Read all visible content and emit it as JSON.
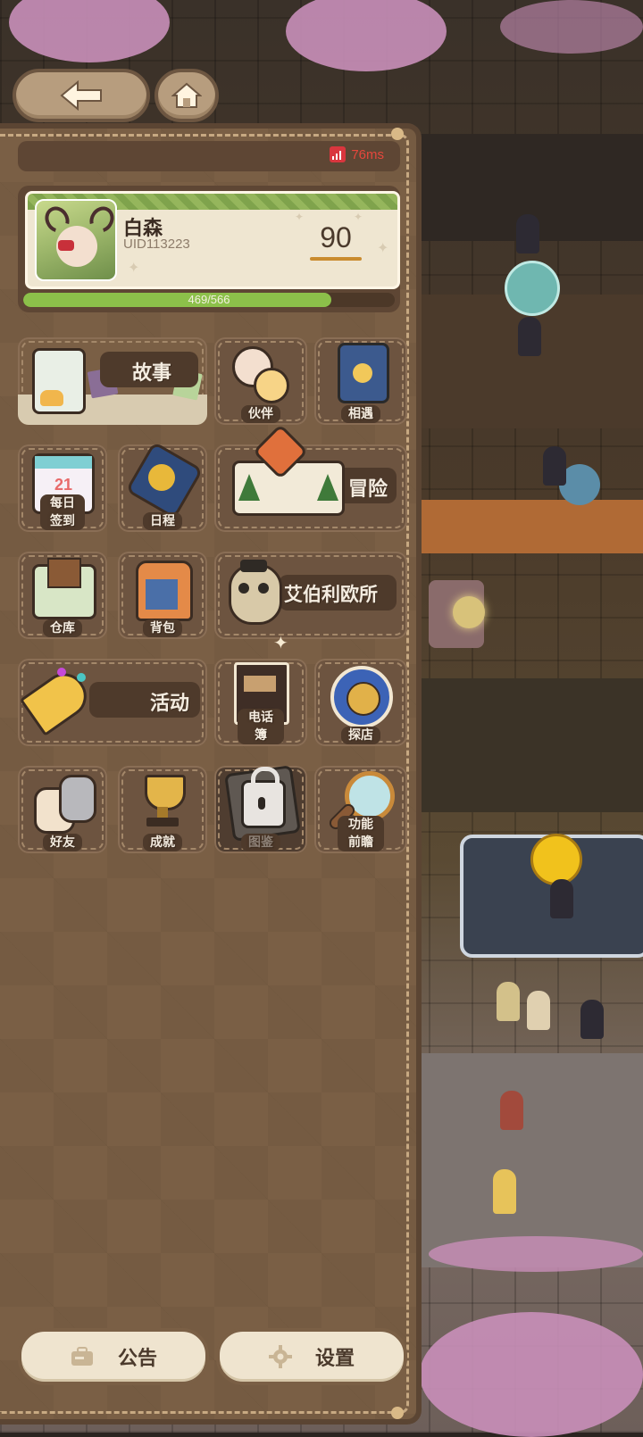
{
  "status": {
    "latency": "76ms"
  },
  "profile": {
    "name": "白森",
    "uid": "UID113223",
    "level": "90",
    "xp_text": "469/566",
    "xp_fraction": 0.8286
  },
  "menu": {
    "story": "故事",
    "partner": "伙伴",
    "encounter": "相遇",
    "daily_checkin": "每日签到",
    "schedule": "日程",
    "adventure": "冒险",
    "warehouse": "仓库",
    "backpack": "背包",
    "abelio_office": "艾伯利欧所",
    "event": "活动",
    "phonebook": "电话簿",
    "explore_shop": "探店",
    "friends": "好友",
    "achievements": "成就",
    "catalog": "图鉴",
    "feature_preview": "功能前瞻"
  },
  "footer": {
    "announcement": "公告",
    "settings": "设置"
  },
  "icons": {
    "back": "back-arrow-icon",
    "home": "home-icon",
    "signal": "signal-icon",
    "lock": "lock-icon",
    "announcement": "briefcase-icon",
    "settings": "gear-icon"
  },
  "colors": {
    "latency": "#e5473c",
    "xp_fill": "#8cc04a",
    "panel": "#7a5f45"
  }
}
